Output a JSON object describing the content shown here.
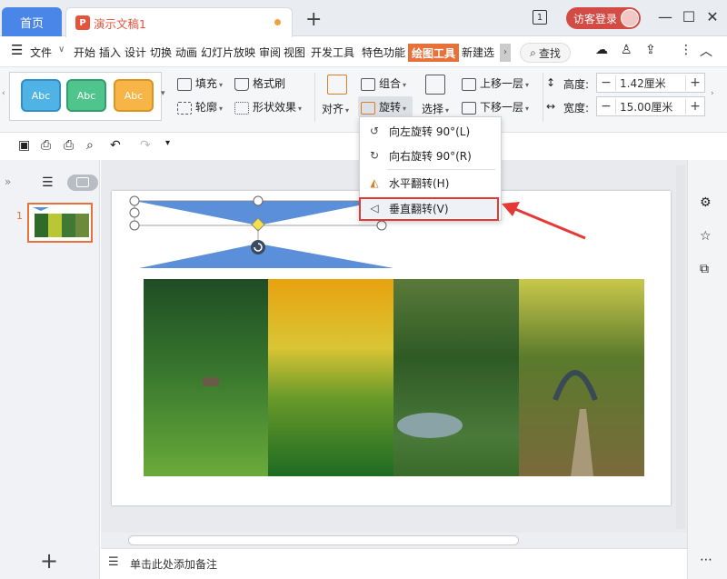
{
  "titlebar": {
    "home_tab": "首页",
    "doc_tab": "演示文稿1",
    "new_tab": "+",
    "page_indicator": "1",
    "login": "访客登录"
  },
  "menu": {
    "items": [
      "文件",
      "开始",
      "插入",
      "设计",
      "切换",
      "动画",
      "幻灯片放映",
      "审阅",
      "视图",
      "开发工具",
      "特色功能",
      "绘图工具",
      "新建选"
    ],
    "search": "查找"
  },
  "ribbon": {
    "style_buttons": [
      "Abc",
      "Abc",
      "Abc"
    ],
    "fill": "填充",
    "format_painter": "格式刷",
    "outline": "轮廓",
    "shape_effect": "形状效果",
    "align": "对齐",
    "group": "组合",
    "rotate": "旋转",
    "select": "选择",
    "bring_forward": "上移一层",
    "send_backward": "下移一层",
    "height_label": "高度:",
    "height_value": "1.42厘米",
    "width_label": "宽度:",
    "width_value": "15.00厘米"
  },
  "dropdown": {
    "items": [
      "向左旋转 90°(L)",
      "向右旋转 90°(R)",
      "水平翻转(H)",
      "垂直翻转(V)"
    ]
  },
  "slides": {
    "thumb_number": "1"
  },
  "notes": {
    "placeholder": "单击此处添加备注"
  },
  "colors": {
    "accent": "#e8713a",
    "brand": "#4a86e8",
    "highlight": "#e53935",
    "shape": "#5b8fd9"
  }
}
